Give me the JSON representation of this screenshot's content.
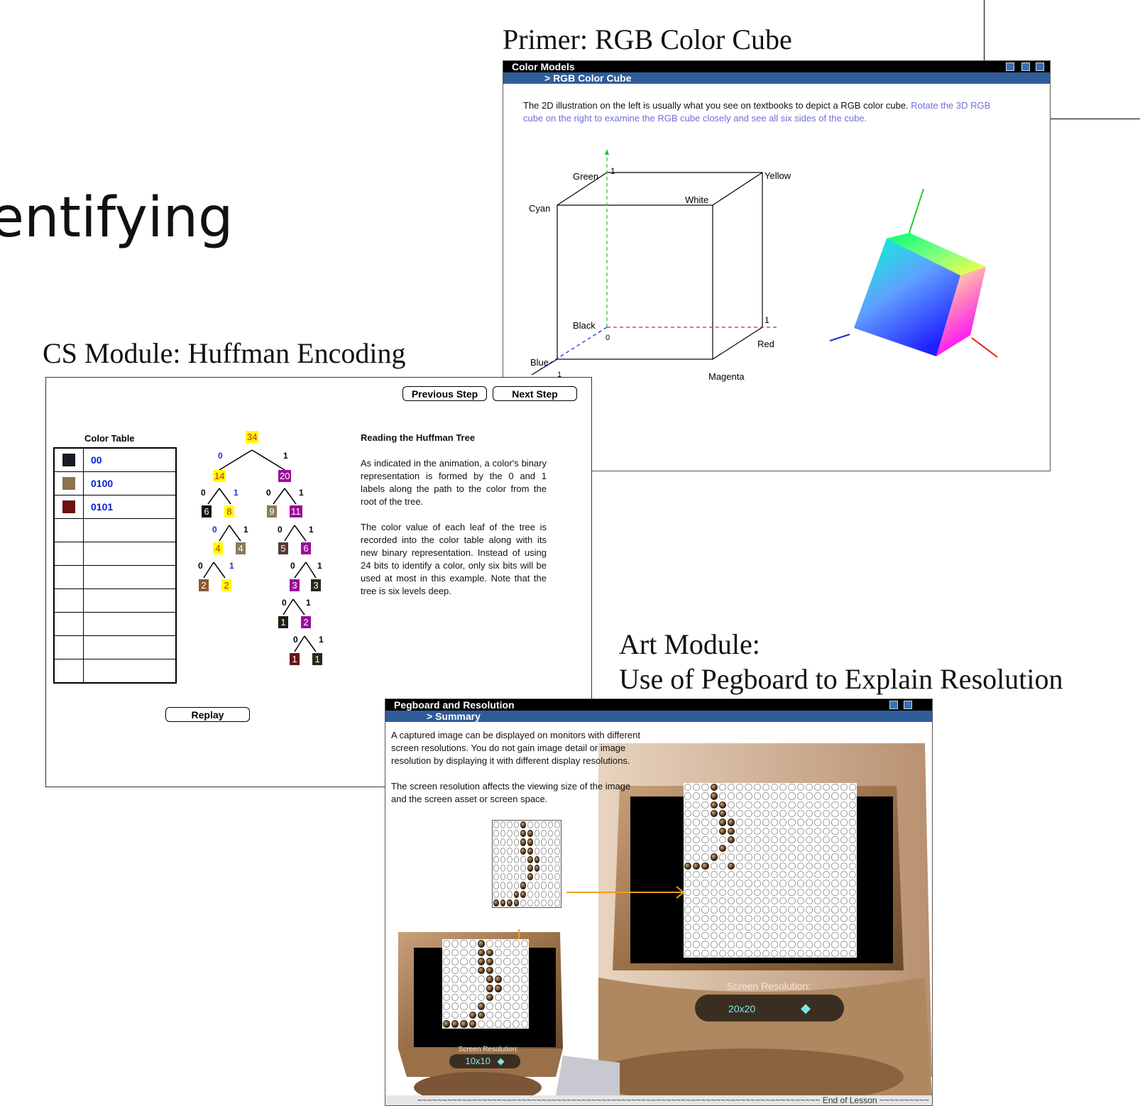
{
  "slide": {
    "partial_title": "entifying",
    "captions": {
      "rgb": "Primer: RGB Color Cube",
      "huffman": "CS Module: Huffman Encoding",
      "art_line1": "Art Module:",
      "art_line2": "Use of Pegboard to Explain Resolution"
    }
  },
  "rgb_window": {
    "title": "Color Models",
    "subtitle": "> RGB Color Cube",
    "desc_main": "The 2D illustration on the left is usually what you see on textbooks to depict a RGB color cube.  ",
    "desc_link": "Rotate the 3D RGB cube on the right to examine the RGB cube closely and see all six sides of the cube.",
    "labels": {
      "green": "Green",
      "one_g": "1",
      "yellow": "Yellow",
      "white": "White",
      "cyan": "Cyan",
      "black": "Black",
      "one_r": "1",
      "zero": "0",
      "red": "Red",
      "blue": "Blue",
      "one_b": "1",
      "magenta": "Magenta"
    }
  },
  "huffman_window": {
    "prev_label": "Previous Step",
    "next_label": "Next Step",
    "replay_label": "Replay",
    "table_title": "Color Table",
    "table_rows": [
      {
        "color": "#1a1a24",
        "code": "00"
      },
      {
        "color": "#8a7250",
        "code": "0100"
      },
      {
        "color": "#6a1414",
        "code": "0101"
      },
      {
        "color": "",
        "code": ""
      },
      {
        "color": "",
        "code": ""
      },
      {
        "color": "",
        "code": ""
      },
      {
        "color": "",
        "code": ""
      },
      {
        "color": "",
        "code": ""
      },
      {
        "color": "",
        "code": ""
      },
      {
        "color": "",
        "code": ""
      }
    ],
    "text_heading": "Reading the Huffman Tree",
    "text_p1": "As indicated in the animation, a color's binary representation is formed by the 0 and 1 labels along the path to the color from the root of the tree.",
    "text_p2": "The color value of each leaf of the tree is recorded into the color table along with its new binary representation. Instead of using 24 bits to identify a color, only six bits will be used at most in this example.  Note that the tree is six levels deep.",
    "tree": {
      "n34": "34",
      "n14": "14",
      "n20": "20",
      "n6a": "6",
      "n8": "8",
      "n9": "9",
      "n11": "11",
      "n4a": "4",
      "n4b": "4",
      "n5": "5",
      "n6b": "6",
      "n2a": "2",
      "n2b": "2",
      "n3a": "3",
      "n3b": "3",
      "n1a": "1",
      "n2c": "2",
      "n1b": "1",
      "n1c": "1",
      "zero": "0",
      "one": "1"
    }
  },
  "pegboard_window": {
    "title": "Pegboard and Resolution",
    "subtitle": "> Summary",
    "p1": "A captured image can be displayed on monitors with different screen resolutions.  You do not gain image detail or image resolution by displaying it with different display resolutions.",
    "p2": "The screen resolution affects the viewing size of the image and the screen asset or screen space.",
    "small_res_label": "Screen Resolution:",
    "small_res_value": "10x10",
    "large_res_label": "Screen Resolution:",
    "large_res_value": "20x20",
    "footer": "~~~~~~~~~~~~~~~~~~~~~~~~~~~~~~~~~~~~~~~~~~~~~~~~~~~~~~~~~~~~~~~~~~~~~~~~~~~~~~~~~ End of Lesson ~~~~~~~~~~"
  },
  "colors": {
    "title_bar": "#000000",
    "sub_bar": "#2f5d99",
    "node_yellow": "#ffff00",
    "node_purple": "#9b0c9b",
    "code_blue": "#0a1fd1",
    "arrow_orange": "#f0a020",
    "pill_text": "#7fe6e6"
  }
}
